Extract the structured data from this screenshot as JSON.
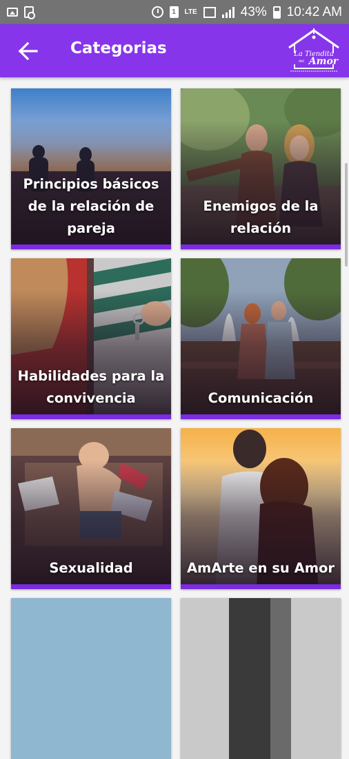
{
  "status_bar": {
    "battery": "43%",
    "time": "10:42 AM",
    "network": "LTE"
  },
  "app_bar": {
    "title": "Categorias",
    "logo_text": "La Tiendita del Amor",
    "accent_color": "#8635ea"
  },
  "categories": [
    {
      "label": "Principios básicos de la relación de pareja",
      "photo": "sunset-couple"
    },
    {
      "label": "Enemigos de la relación",
      "photo": "couple-arguing"
    },
    {
      "label": "Habilidades para la convivencia",
      "photo": "keys-handover"
    },
    {
      "label": "Comunicación",
      "photo": "couple-fountain"
    },
    {
      "label": "Sexualidad",
      "photo": "couple-embrace"
    },
    {
      "label": "AmArte en su Amor",
      "photo": "couple-sunset-hug"
    },
    {
      "label": "",
      "photo": "partial-sky"
    },
    {
      "label": "",
      "photo": "partial-bw"
    }
  ]
}
